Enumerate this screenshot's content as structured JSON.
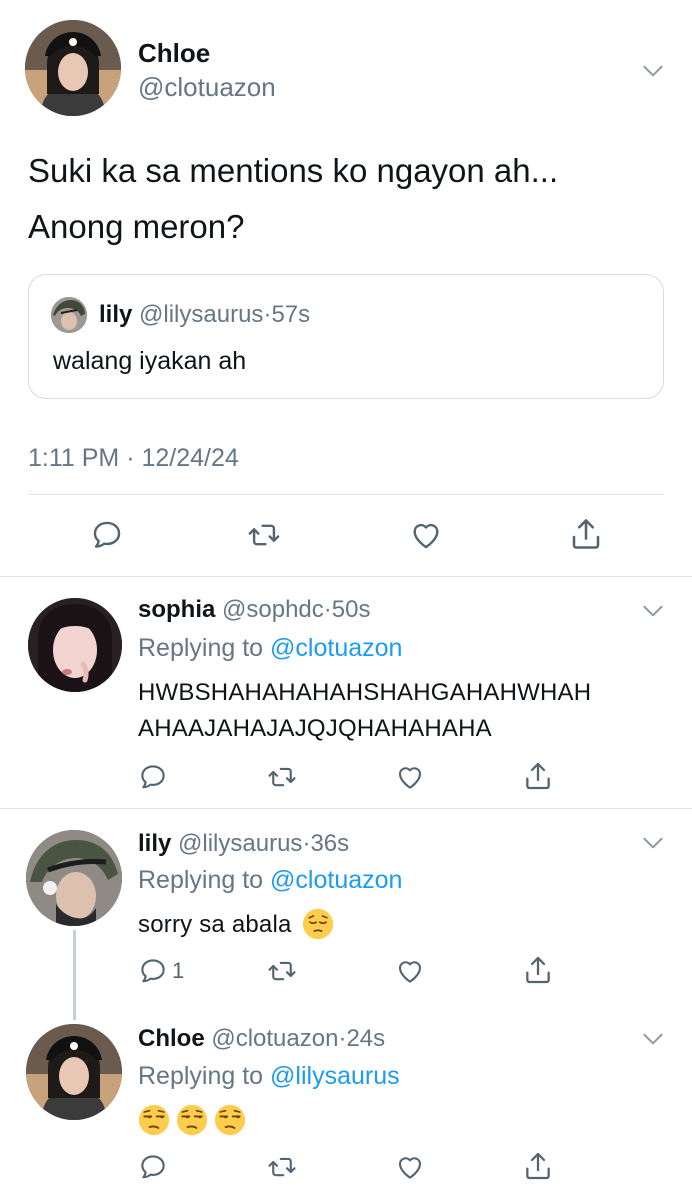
{
  "main_tweet": {
    "name": "Chloe",
    "handle": "@clotuazon",
    "text_line1": "Suki ka sa mentions ko ngayon ah...",
    "text_line2": "Anong meron?",
    "quote": {
      "name": "lily",
      "handle": "@lilysaurus",
      "separator": "·",
      "time": "57s",
      "text": "walang iyakan ah"
    },
    "timestamp": "1:11 PM · 12/24/24"
  },
  "replies": [
    {
      "name": "sophia",
      "handle": "@sophdc",
      "separator": "·",
      "time": "50s",
      "replying_prefix": "Replying to",
      "replying_to": "@clotuazon",
      "text_line1": "HWBSHAHAHAHAHSHAHGAHAHWHAH",
      "text_line2": "AHAAJAHAJAJQJQHAHAHAHA",
      "reply_count": ""
    },
    {
      "name": "lily",
      "handle": "@lilysaurus",
      "separator": "·",
      "time": "36s",
      "replying_prefix": "Replying to",
      "replying_to": "@clotuazon",
      "text": "sorry sa abala",
      "emoji": "pensive-face",
      "reply_count": "1"
    },
    {
      "name": "Chloe",
      "handle": "@clotuazon",
      "separator": "·",
      "time": "24s",
      "replying_prefix": "Replying to",
      "replying_to": "@lilysaurus",
      "emojis": [
        "unamused-face",
        "unamused-face",
        "unamused-face"
      ],
      "reply_count": ""
    }
  ],
  "icons": {
    "reply": "reply-icon",
    "retweet": "retweet-icon",
    "like": "heart-icon",
    "share": "share-icon",
    "more": "chevron-down-icon"
  },
  "colors": {
    "text": "#0f1419",
    "muted": "#657786",
    "link": "#1d9bf0",
    "border": "#dfe3e6",
    "emoji": "#ffcc4d"
  }
}
